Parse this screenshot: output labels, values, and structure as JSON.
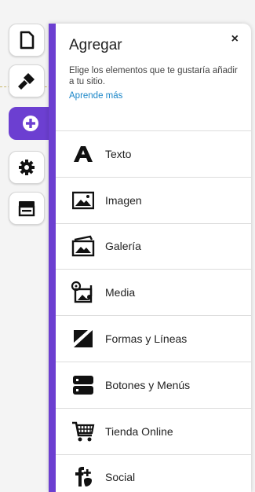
{
  "rail": {
    "items": [
      {
        "name": "pages",
        "icon": "page-icon"
      },
      {
        "name": "design",
        "icon": "paintbrush-icon"
      },
      {
        "name": "add",
        "icon": "plus-circle-icon",
        "active": true
      },
      {
        "name": "settings",
        "icon": "gear-icon"
      },
      {
        "name": "store",
        "icon": "storefront-icon"
      }
    ]
  },
  "panel": {
    "title": "Agregar",
    "close_label": "×",
    "description": "Elige los elementos que te gustaría añadir a tu sitio.",
    "learn_more": "Aprende más",
    "items": [
      {
        "label": "Texto",
        "icon": "text-icon"
      },
      {
        "label": "Imagen",
        "icon": "image-icon"
      },
      {
        "label": "Galería",
        "icon": "gallery-icon"
      },
      {
        "label": "Media",
        "icon": "media-icon"
      },
      {
        "label": "Formas y Líneas",
        "icon": "shapes-icon"
      },
      {
        "label": "Botones y Menús",
        "icon": "buttons-icon"
      },
      {
        "label": "Tienda Online",
        "icon": "shopping-cart-icon"
      },
      {
        "label": "Social",
        "icon": "social-icon"
      }
    ]
  },
  "colors": {
    "accent": "#6c3fd1",
    "link": "#1a86c8"
  }
}
